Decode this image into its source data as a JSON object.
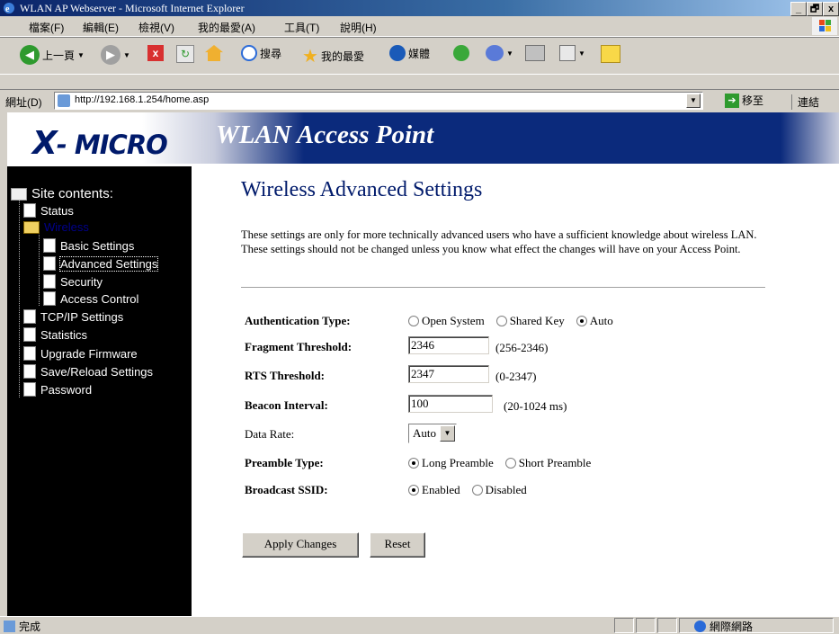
{
  "window": {
    "title": "WLAN AP Webserver - Microsoft Internet Explorer",
    "controls": [
      "_",
      "🗗",
      "x"
    ]
  },
  "menu": [
    "檔案(F)",
    "編輯(E)",
    "檢視(V)",
    "我的最愛(A)",
    "工具(T)",
    "說明(H)"
  ],
  "toolbar": {
    "back": "上一頁",
    "search": "搜尋",
    "favorites": "我的最愛",
    "media": "媒體"
  },
  "address": {
    "label": "網址(D)",
    "url": "http://192.168.1.254/home.asp",
    "go": "移至",
    "links": "連結"
  },
  "banner": {
    "logo_x": "X",
    "logo_rest": "- MICRO",
    "title": "WLAN Access Point"
  },
  "sidebar": {
    "header": "Site contents:",
    "items": [
      "Status",
      "Wireless",
      "Basic Settings",
      "Advanced Settings",
      "Security",
      "Access Control",
      "TCP/IP Settings",
      "Statistics",
      "Upgrade Firmware",
      "Save/Reload Settings",
      "Password"
    ]
  },
  "page": {
    "title": "Wireless Advanced Settings",
    "description": "These settings are only for more technically advanced users who have a sufficient knowledge about wireless LAN. These settings should not be changed unless you know what effect the changes will have on your Access Point."
  },
  "form": {
    "auth": {
      "label": "Authentication Type:",
      "options": [
        "Open System",
        "Shared Key",
        "Auto"
      ],
      "selected": "Auto"
    },
    "frag": {
      "label": "Fragment Threshold:",
      "value": "2346",
      "range": "(256-2346)"
    },
    "rts": {
      "label": "RTS Threshold:",
      "value": "2347",
      "range": "(0-2347)"
    },
    "beacon": {
      "label": "Beacon Interval:",
      "value": "100",
      "range": "(20-1024 ms)"
    },
    "rate": {
      "label": "Data Rate:",
      "value": "Auto"
    },
    "preamble": {
      "label": "Preamble Type:",
      "options": [
        "Long Preamble",
        "Short Preamble"
      ],
      "selected": "Long Preamble"
    },
    "ssid": {
      "label": "Broadcast SSID:",
      "options": [
        "Enabled",
        "Disabled"
      ],
      "selected": "Enabled"
    },
    "apply": "Apply Changes",
    "reset": "Reset"
  },
  "status": {
    "left": "完成",
    "zone": "網際網路"
  }
}
